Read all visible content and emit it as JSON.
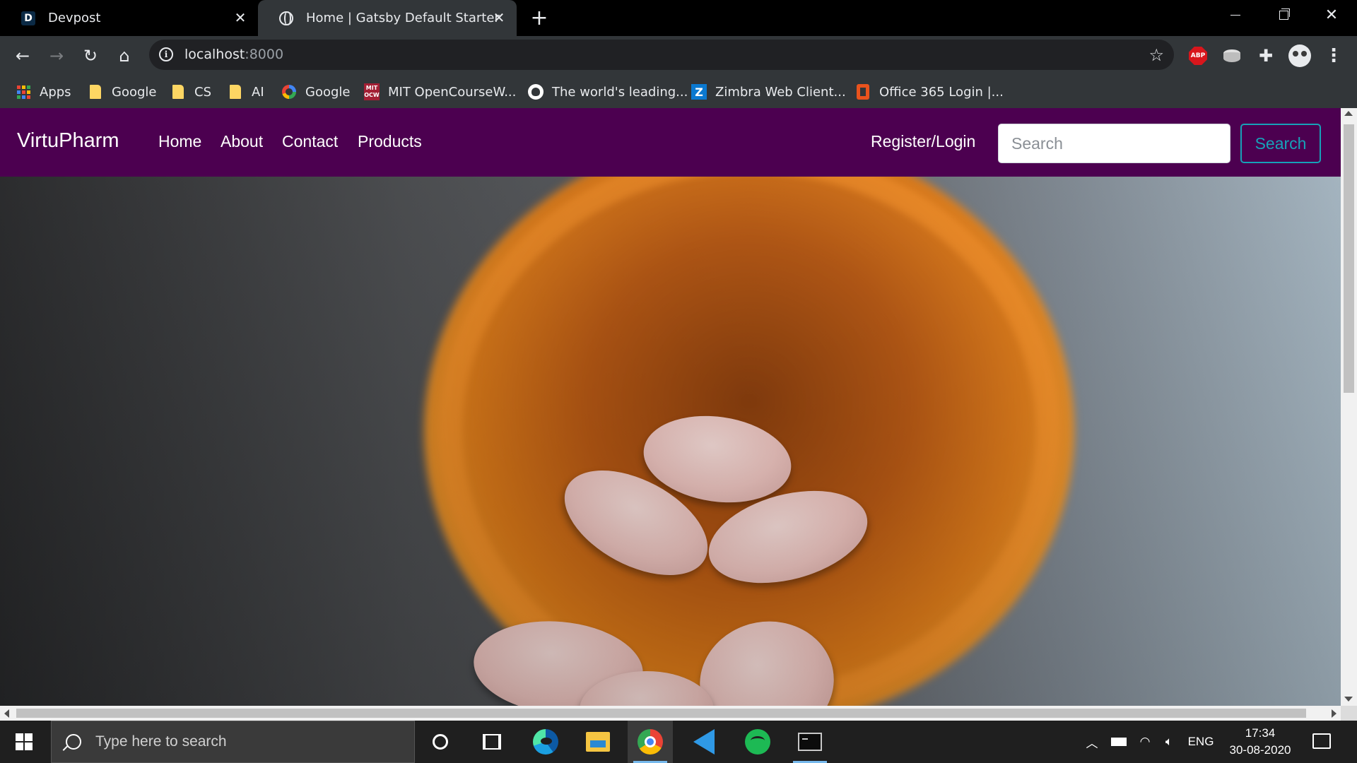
{
  "browser": {
    "tabs": [
      {
        "title": "Devpost",
        "favicon": "devpost-d-icon",
        "active": false
      },
      {
        "title": "Home | Gatsby Default Starter",
        "favicon": "globe-icon",
        "active": true
      }
    ],
    "address": {
      "host": "localhost",
      "port": ":8000"
    },
    "bookmarks": [
      {
        "label": "Apps",
        "icon": "apps-grid-icon"
      },
      {
        "label": "Google",
        "icon": "folder-icon"
      },
      {
        "label": "CS",
        "icon": "folder-icon"
      },
      {
        "label": "AI",
        "icon": "folder-icon"
      },
      {
        "label": "Google",
        "icon": "google-icon"
      },
      {
        "label": "MIT OpenCourseW...",
        "icon": "mit-ocw-icon"
      },
      {
        "label": "The world's leading...",
        "icon": "github-icon"
      },
      {
        "label": "Zimbra Web Client...",
        "icon": "zimbra-icon"
      },
      {
        "label": "Office 365 Login |...",
        "icon": "office-icon"
      }
    ],
    "extensions": {
      "abp_label": "ABP"
    }
  },
  "site": {
    "brand": "VirtuPharm",
    "nav": [
      {
        "label": "Home"
      },
      {
        "label": "About"
      },
      {
        "label": "Contact"
      },
      {
        "label": "Products"
      }
    ],
    "auth_link": "Register/Login",
    "search": {
      "placeholder": "Search",
      "button_label": "Search"
    },
    "colors": {
      "navbar": "#4c0050",
      "search_button": "#17a2b8"
    },
    "hero": {
      "description_icon": "pill-bottle-image"
    }
  },
  "taskbar": {
    "search_placeholder": "Type here to search",
    "language": "ENG",
    "time": "17:34",
    "date": "30-08-2020"
  }
}
